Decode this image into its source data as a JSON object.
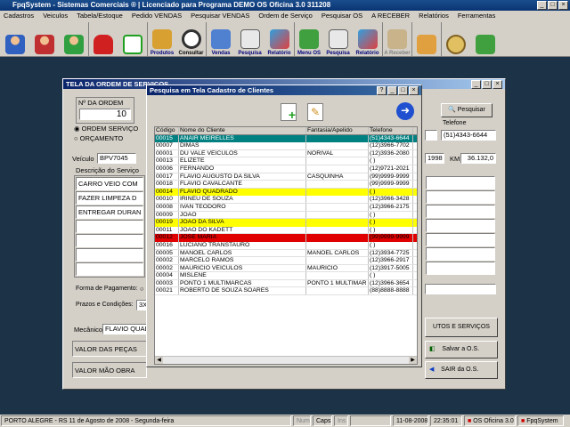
{
  "app": {
    "title": "FpqSystem - Sistemas Comerciais ®  |  Licenciado para  Programa DEMO OS Oficina 3.0 311208"
  },
  "menu": [
    "Cadastros",
    "Veiculos",
    "Tabela/Estoque",
    "Pedido VENDAS",
    "Pesquisar VENDAS",
    "Ordem de Serviço",
    "Pesquisar OS",
    "A RECEBER",
    "Relatórios",
    "Ferramentas"
  ],
  "toolbar": {
    "produtos": "Produtos",
    "consultar": "Consultar",
    "vendas": "Vendas",
    "pesquisa": "Pesquisa",
    "relatorio": "Relatório",
    "menu_os": "Menu OS",
    "pesquisa2": "Pesquisa",
    "relatorio2": "Relatório",
    "a_receber": "A Receber"
  },
  "os_window": {
    "title": "TELA DA ORDEM DE SERVIÇOS",
    "n_ordem_label": "Nº DA ORDEM",
    "n_ordem": "10",
    "radio1": "ORDEM SERVIÇO",
    "radio2": "ORÇAMENTO",
    "pesquisar": "Pesquisar",
    "telefone_label": "Telefone",
    "telefone": "(51)4343-6644",
    "veiculo_label": "Veículo",
    "veiculo": "BPV7045",
    "ano": "1998",
    "km_label": "KM",
    "km": "36.132,0",
    "descricao_label": "Descrição do Serviço",
    "servicos": [
      "CARRO VEIO COM",
      "FAZER LIMPEZA D",
      "ENTREGAR DURAN"
    ],
    "forma_pag_label": "Forma de Pagamento:",
    "prazos_label": "Prazos e Condições:",
    "prazos": "3X",
    "mecanico_label": "Mecânico",
    "mecanico": "FLAVIO QUADR",
    "valor_pecas": "VALOR DAS PEÇAS",
    "valor_mao": "VALOR MÃO OBRA",
    "produtos_servicos": "UTOS E SERVIÇOS",
    "salvar": "Salvar a O.S.",
    "sair": "SAIR da O.S."
  },
  "dialog": {
    "title": "Pesquisa em Tela Cadastro de Clientes",
    "columns": [
      "Código",
      "Nome do Cliente",
      "Fantasia/Apelido",
      "Telefone"
    ],
    "rows": [
      [
        "00015",
        "ANAIR MEIRELLES",
        "",
        "(51)4343-6644"
      ],
      [
        "00007",
        "DIMAS",
        "",
        "(12)3966-7702"
      ],
      [
        "00001",
        "DU VALE VEICULOS",
        "NORIVAL",
        "(12)3936-2080"
      ],
      [
        "00013",
        "ELIZETE",
        "",
        "(  )"
      ],
      [
        "00006",
        "FERNANDO",
        "",
        "(12)9721-2021"
      ],
      [
        "00017",
        "FLAVIO AUGUSTO DA SILVA",
        "CASQUINHA",
        "(99)9999-9999"
      ],
      [
        "00018",
        "FLAVIO CAVALCANTE",
        "",
        "(99)9999-9999"
      ],
      [
        "00014",
        "FLAVIO QUADRADO",
        "",
        "(  )"
      ],
      [
        "00010",
        "IRINEU DE SOUZA",
        "",
        "(12)3966-3428"
      ],
      [
        "00008",
        "IVAN TEODORO",
        "",
        "(12)3966-2175"
      ],
      [
        "00009",
        "JOÃO",
        "",
        "(  )"
      ],
      [
        "00019",
        "JOÃO DA SILVA",
        "",
        "(  )"
      ],
      [
        "00011",
        "JOÃO DO KADETT",
        "",
        "(  )"
      ],
      [
        "00012",
        "JOSÉ MARIA",
        "",
        "(99)9999-9999"
      ],
      [
        "00016",
        "LUCIANO TRANSTAURO",
        "",
        "(  )"
      ],
      [
        "00005",
        "MANOEL CARLOS",
        "MANOEL CARLOS",
        "(12)3934-7725"
      ],
      [
        "00002",
        "MARCELO RAMOS",
        "",
        "(12)3966-2917"
      ],
      [
        "00002",
        "MAURICIO VEICULOS",
        "MAURICIO",
        "(12)3917-5005"
      ],
      [
        "00004",
        "MISLENE",
        "",
        "(  )"
      ],
      [
        "00003",
        "PONTO 1 MULTIMARCAS",
        "PONTO 1 MULTIMAR",
        "(12)3966-3654"
      ],
      [
        "00021",
        "ROBERTO DE SOUZA SOARES",
        "",
        "(88)8888-8888"
      ]
    ],
    "row_colors": {
      "0": "#008080",
      "7": "#ffff00",
      "11": "#ffff00",
      "13": "#e00000"
    }
  },
  "status": {
    "city": "PORTO ALEGRE - RS 11 de Agosto de 2008 - Segunda-feira",
    "num": "Num",
    "caps": "Caps",
    "ins": "Ins",
    "date": "11-08-2008",
    "time": "22:35:01",
    "version": "OS Oficina 3.0",
    "brand": "FpqSystem"
  }
}
